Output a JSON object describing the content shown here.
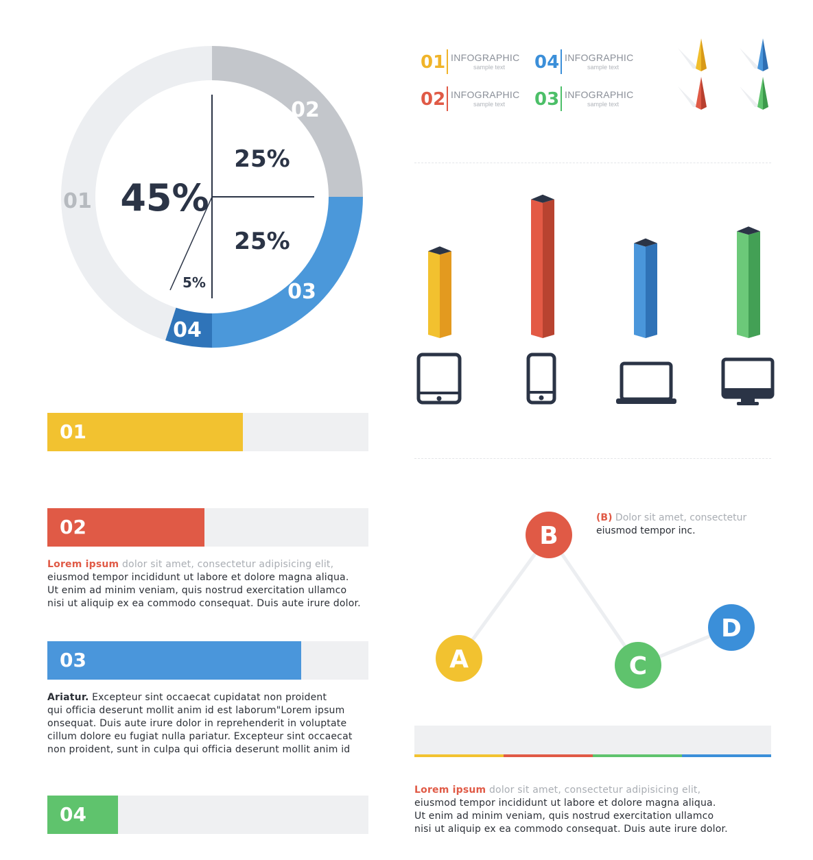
{
  "donut": {
    "center_value": "45%",
    "quadrant_top": "25%",
    "quadrant_bottom": "25%",
    "slice_small": "5%",
    "segments": [
      {
        "label": "01",
        "percent": 45,
        "color": "#eceef1",
        "label_color": "#b6babf"
      },
      {
        "label": "02",
        "percent": 25,
        "color": "#c3c6cb",
        "label_color": "#ffffff"
      },
      {
        "label": "03",
        "percent": 25,
        "color": "#4b98da",
        "label_color": "#ffffff"
      },
      {
        "label": "04",
        "percent": 5,
        "color": "#2f74b9",
        "label_color": "#ffffff"
      }
    ],
    "text_color": "#2b3446"
  },
  "legend": [
    {
      "num": "01",
      "title": "INFOGRAPHIC",
      "sub": "sample text",
      "color": "#f0b429"
    },
    {
      "num": "04",
      "title": "INFOGRAPHIC",
      "sub": "sample text",
      "color": "#3b8fd9"
    },
    {
      "num": "02",
      "title": "INFOGRAPHIC",
      "sub": "sample text",
      "color": "#e05a46"
    },
    {
      "num": "03",
      "title": "INFOGRAPHIC",
      "sub": "sample text",
      "color": "#4cbf68"
    }
  ],
  "pins": [
    {
      "name": "yellow-pin-icon",
      "color": "#f1be2c",
      "shade": "#d89a18"
    },
    {
      "name": "blue-pin-icon",
      "color": "#4a96db",
      "shade": "#2f6fb3"
    },
    {
      "name": "red-pin-icon",
      "color": "#e05a46",
      "shade": "#b8402f"
    },
    {
      "name": "green-pin-icon",
      "color": "#5fc36d",
      "shade": "#3d9a4c"
    }
  ],
  "bars3d": [
    {
      "value": 0.42,
      "front": "#f2c12f",
      "side": "#e39a1f",
      "device": "tablet-icon"
    },
    {
      "value": 0.68,
      "front": "#e35a45",
      "side": "#b84330",
      "device": "phone-icon"
    },
    {
      "value": 0.46,
      "front": "#4a96db",
      "side": "#2f72b7",
      "device": "laptop-icon"
    },
    {
      "value": 0.52,
      "front": "#6cc979",
      "side": "#43a055",
      "device": "monitor-icon"
    }
  ],
  "progress": [
    {
      "label": "01",
      "value": 0.61,
      "color": "#f2c230"
    },
    {
      "label": "02",
      "value": 0.49,
      "color": "#e05a46"
    },
    {
      "label": "03",
      "value": 0.79,
      "color": "#4a96db"
    },
    {
      "label": "04",
      "value": 0.22,
      "color": "#5fc36d"
    }
  ],
  "text1": {
    "lead": "Lorem ipsum",
    "soft": " dolor sit amet, consectetur adipisicing elit,",
    "lines": [
      "eiusmod tempor incididunt ut labore et dolore magna aliqua.",
      "Ut enim ad minim veniam, quis nostrud exercitation ullamco",
      "nisi ut aliquip ex ea commodo consequat. Duis aute irure dolor."
    ]
  },
  "text2": {
    "lead": "Ariatur.",
    "first": " Excepteur sint occaecat cupidatat non proident",
    "lines": [
      "qui officia deserunt mollit anim id est laborum\"Lorem ipsum",
      "onsequat. Duis aute irure dolor in reprehenderit in voluptate",
      "cillum dolore eu fugiat nulla pariatur. Excepteur sint occaecat",
      "non proident, sunt in culpa qui officia deserunt mollit anim id"
    ]
  },
  "network": {
    "nodes": [
      {
        "label": "A",
        "color": "#f2c230"
      },
      {
        "label": "B",
        "color": "#e05a46"
      },
      {
        "label": "C",
        "color": "#5fc36d"
      },
      {
        "label": "D",
        "color": "#3b8fd9"
      }
    ],
    "note": {
      "tag": "(B)",
      "soft": " Dolor sit amet, consectetur",
      "line2": "eiusmod tempor inc."
    }
  },
  "stripe_colors": [
    "#f2c230",
    "#e05a46",
    "#5fc36d",
    "#3b8fd9"
  ],
  "text3": {
    "lead": "Lorem ipsum",
    "soft": " dolor sit amet, consectetur adipisicing elit,",
    "lines": [
      "eiusmod tempor incididunt ut labore et dolore magna aliqua.",
      "Ut enim ad minim veniam, quis nostrud exercitation ullamco",
      "nisi ut aliquip ex ea commodo consequat. Duis aute irure dolor."
    ]
  }
}
